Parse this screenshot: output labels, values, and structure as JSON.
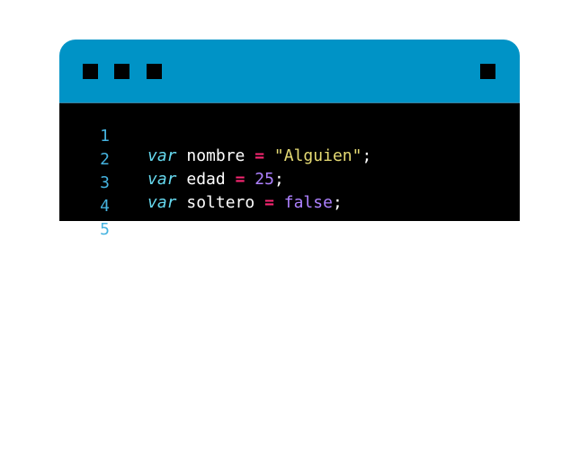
{
  "window": {
    "titlebar_buttons": [
      "left-square-1",
      "left-square-2",
      "left-square-3",
      "right-square"
    ]
  },
  "editor": {
    "lines": [
      {
        "number": "1",
        "keyword": "var",
        "identifier": "nombre",
        "operator": "=",
        "value": "\"Alguien\"",
        "value_type": "string",
        "end": ";"
      },
      {
        "number": "2",
        "keyword": "var",
        "identifier": "edad",
        "operator": "=",
        "value": "25",
        "value_type": "number",
        "end": ";"
      },
      {
        "number": "3",
        "keyword": "var",
        "identifier": "soltero",
        "operator": "=",
        "value": "false",
        "value_type": "boolean",
        "end": ";"
      },
      {
        "number": "4"
      },
      {
        "number": "5"
      }
    ]
  },
  "colors": {
    "titlebar": "#0093c6",
    "editor_background": "#000000",
    "line_number": "#45b3e0",
    "keyword": "#66d9ef",
    "operator": "#f92672",
    "string": "#e6db74",
    "number": "#ae81ff",
    "boolean": "#ae81ff"
  }
}
